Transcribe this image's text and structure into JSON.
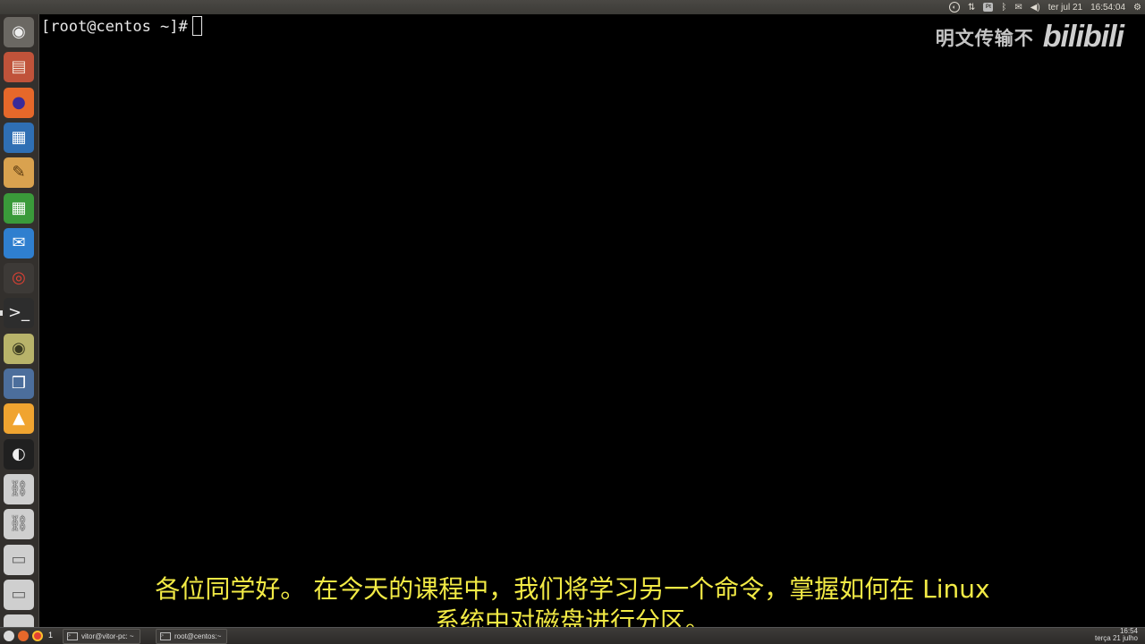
{
  "top_panel": {
    "date": "ter jul 21",
    "time": "16:54:04",
    "indicators": [
      "obs-icon",
      "network-icon",
      "keyboard-pt-icon",
      "bluetooth-icon",
      "mail-icon",
      "volume-icon",
      "power-gear-icon"
    ],
    "keyboard_label": "Pt"
  },
  "launcher": {
    "items": [
      {
        "name": "dash-home-icon",
        "glyph": "◉",
        "bg": "#6b6863",
        "color": "#eeeeee"
      },
      {
        "name": "files-icon",
        "glyph": "▤",
        "bg": "#c0533a",
        "color": "#f3e3d6"
      },
      {
        "name": "firefox-icon",
        "glyph": "●",
        "bg": "#e6682a",
        "color": "#3a2a9a"
      },
      {
        "name": "libreoffice-writer-icon",
        "glyph": "▦",
        "bg": "#2f6fb4",
        "color": "#ffffff"
      },
      {
        "name": "text-editor-icon",
        "glyph": "✎",
        "bg": "#d9a24f",
        "color": "#5a3a10"
      },
      {
        "name": "libreoffice-calc-icon",
        "glyph": "▦",
        "bg": "#3a9a3a",
        "color": "#ffffff"
      },
      {
        "name": "thunderbird-icon",
        "glyph": "✉",
        "bg": "#2f7fcf",
        "color": "#ffffff"
      },
      {
        "name": "chrome-icon",
        "glyph": "◎",
        "bg": "#3d3a37",
        "color": "#e34133"
      },
      {
        "name": "terminal-icon",
        "glyph": ">_",
        "bg": "#2d2d2d",
        "color": "#eeeeee"
      },
      {
        "name": "audio-player-icon",
        "glyph": "◉",
        "bg": "#b8b36a",
        "color": "#3a3a20"
      },
      {
        "name": "virtualbox-icon",
        "glyph": "❒",
        "bg": "#4c6e9c",
        "color": "#ffffff"
      },
      {
        "name": "vlc-64-icon",
        "glyph": "▲",
        "bg": "#f0a430",
        "color": "#ffffff"
      },
      {
        "name": "obs-studio-icon",
        "glyph": "◐",
        "bg": "#202020",
        "color": "#eeeeee"
      },
      {
        "name": "usb-drive-icon",
        "glyph": "⛓",
        "bg": "#cfcfcf",
        "color": "#666666"
      },
      {
        "name": "usb-drive-icon",
        "glyph": "⛓",
        "bg": "#cfcfcf",
        "color": "#666666"
      },
      {
        "name": "drive-icon",
        "glyph": "▭",
        "bg": "#cfcfcf",
        "color": "#666666"
      },
      {
        "name": "drive-icon",
        "glyph": "▭",
        "bg": "#cfcfcf",
        "color": "#666666"
      },
      {
        "name": "drive-icon",
        "glyph": "▭",
        "bg": "#cfcfcf",
        "color": "#666666"
      }
    ]
  },
  "terminal": {
    "prompt": "[root@centos ~]#"
  },
  "watermark": {
    "text": "明文传输不",
    "logo": "bilibili"
  },
  "subtitles": {
    "line1": "各位同学好。 在今天的课程中，我们将学习另一个命令，掌握如何在 Linux",
    "line2": "系统中对磁盘进行分区。"
  },
  "bottom_panel": {
    "workspace": "1",
    "tasks": [
      {
        "label": "vitor@vitor-pc: ~"
      },
      {
        "label": "root@centos:~"
      }
    ],
    "clock_time": "16:54",
    "clock_date": "terça 21 julho"
  },
  "colors": {
    "subtitle": "#f2ea45",
    "terminal_bg": "#000000",
    "panel": "#3c3b37"
  }
}
